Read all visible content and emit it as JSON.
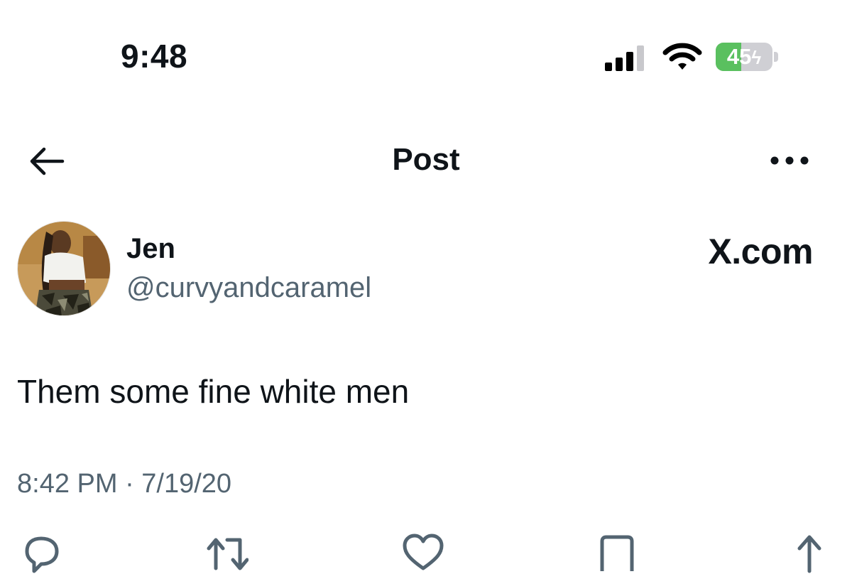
{
  "status_bar": {
    "time": "9:48",
    "battery_level": "45",
    "battery_fraction": 0.45,
    "battery_charging": true
  },
  "nav": {
    "title": "Post",
    "back_icon": "arrow-left-icon",
    "more_icon": "more-horizontal-icon"
  },
  "post": {
    "author_name": "Jen",
    "author_handle": "@curvyandcaramel",
    "source_label": "X.com",
    "text": "Them some fine white men",
    "timestamp": "8:42 PM · 7/19/20"
  },
  "actions": [
    "reply-icon",
    "repost-icon",
    "like-icon",
    "bookmark-icon",
    "share-icon"
  ],
  "colors": {
    "text": "#0f1419",
    "secondary": "#536471",
    "battery_green": "#5ac05f"
  }
}
